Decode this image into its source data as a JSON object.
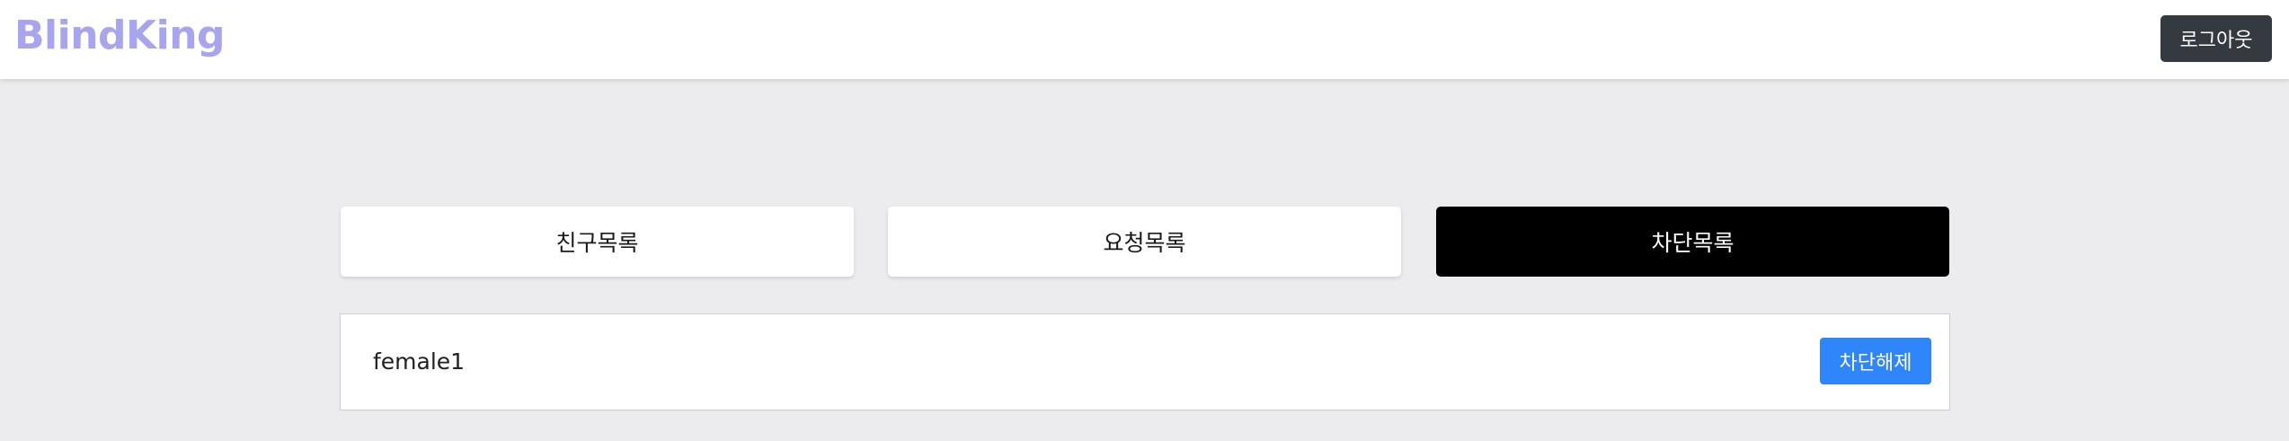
{
  "navbar": {
    "logo": "BlindKing",
    "logout_label": "로그아웃"
  },
  "tabs": [
    {
      "label": "친구목록",
      "active": false
    },
    {
      "label": "요청목록",
      "active": false
    },
    {
      "label": "차단목록",
      "active": true
    }
  ],
  "blocked_list": [
    {
      "username": "female1",
      "action_label": "차단해제"
    }
  ],
  "colors": {
    "logo": "#a7a5ee",
    "logout_button": "#353a40",
    "active_tab": "#000000",
    "unblock_button": "#2f86fb",
    "background": "#ececee"
  }
}
